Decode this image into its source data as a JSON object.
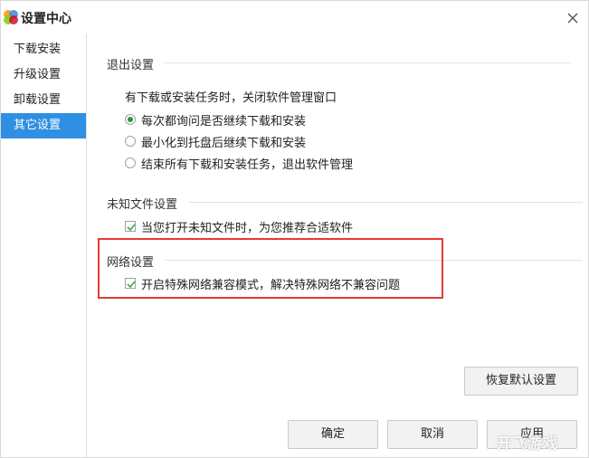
{
  "window": {
    "title": "设置中心"
  },
  "sidebar": {
    "items": [
      {
        "label": "下载安装"
      },
      {
        "label": "升级设置"
      },
      {
        "label": "卸载设置"
      },
      {
        "label": "其它设置",
        "active": true
      }
    ]
  },
  "exit_settings": {
    "title": "退出设置",
    "description": "有下载或安装任务时，关闭软件管理窗口",
    "options": [
      {
        "label": "每次都询问是否继续下载和安装",
        "selected": true
      },
      {
        "label": "最小化到托盘后继续下载和安装",
        "selected": false
      },
      {
        "label": "结束所有下载和安装任务，退出软件管理",
        "selected": false
      }
    ]
  },
  "unknown_file_settings": {
    "title": "未知文件设置",
    "checkbox": {
      "label": "当您打开未知文件时，为您推荐合适软件",
      "checked": true
    }
  },
  "network_settings": {
    "title": "网络设置",
    "checkbox": {
      "label": "开启特殊网络兼容模式，解决特殊网络不兼容问题",
      "checked": true
    }
  },
  "buttons": {
    "restore_default": "恢复默认设置",
    "ok": "确定",
    "cancel": "取消",
    "apply": "应用"
  },
  "watermark": "开飞游戏",
  "colors": {
    "accent": "#2f8fe3",
    "radio_selected": "#2b9a3b",
    "check_mark": "#3aa64a",
    "highlight_border": "#e53935"
  },
  "icons": {
    "logo": "app-logo-icon",
    "close": "close-icon",
    "check": "check-icon"
  }
}
